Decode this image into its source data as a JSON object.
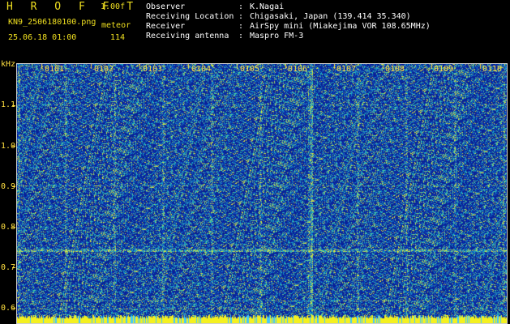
{
  "header": {
    "title": "H R O F F T",
    "version": "1.00f",
    "filename": "KN9_2506180100.png",
    "mode": "meteor",
    "datetime": "25.06.18 01:00",
    "count": "114"
  },
  "info": [
    {
      "label": "Observer",
      "value": "K.Nagai"
    },
    {
      "label": "Receiving Location",
      "value": "Chigasaki, Japan (139.414 35.340)"
    },
    {
      "label": "Receiver",
      "value": "AirSpy mini (Miakejima VOR 108.65MHz)"
    },
    {
      "label": "Receiving antenna",
      "value": "Maspro FM-3"
    }
  ],
  "separator": ":",
  "axis": {
    "unit_label": "kHz",
    "y_ticks": [
      "1.1",
      "1.0",
      "0.9",
      "0.8",
      "0.7",
      "0.6"
    ],
    "x_ticks": [
      "0101",
      "0102",
      "0103",
      "0104",
      "0105",
      "0106",
      "0107",
      "0108",
      "0109",
      "0110"
    ]
  },
  "colors": {
    "header_text": "#f0e020",
    "axis_text": "#ffe040",
    "background": "#0a1e9a"
  }
}
